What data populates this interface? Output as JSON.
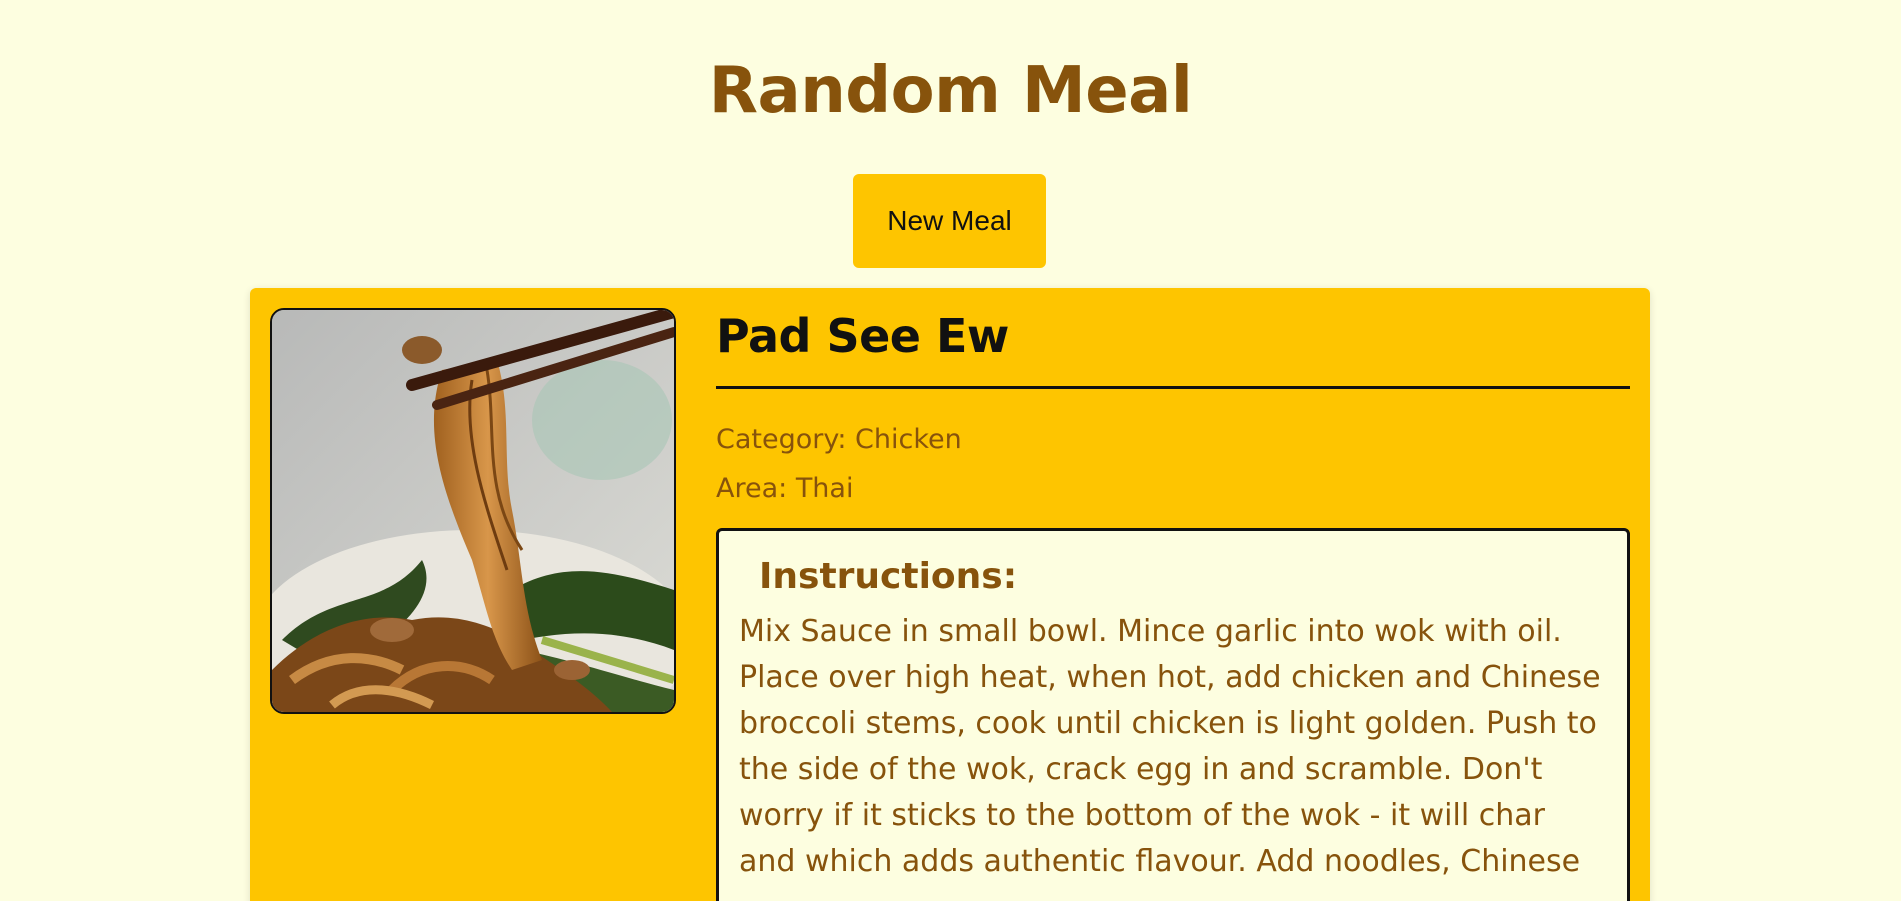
{
  "header": {
    "title": "Random Meal"
  },
  "controls": {
    "new_meal_label": "New Meal"
  },
  "meal": {
    "name": "Pad See Ew",
    "category_label": "Category: Chicken",
    "area_label": "Area: Thai",
    "instructions_heading": "Instructions:",
    "instructions": "Mix Sauce in small bowl. Mince garlic into wok with oil. Place over high heat, when hot, add chicken and Chinese broccoli stems, cook until chicken is light golden. Push to the side of the wok, crack egg in and scramble. Don't worry if it sticks to the bottom of the wok - it will char and which adds authentic flavour. Add noodles, Chinese",
    "image_alt": "Pad See Ew"
  },
  "colors": {
    "background": "#fdfee0",
    "accent": "#fec500",
    "text_brown": "#87530c"
  }
}
